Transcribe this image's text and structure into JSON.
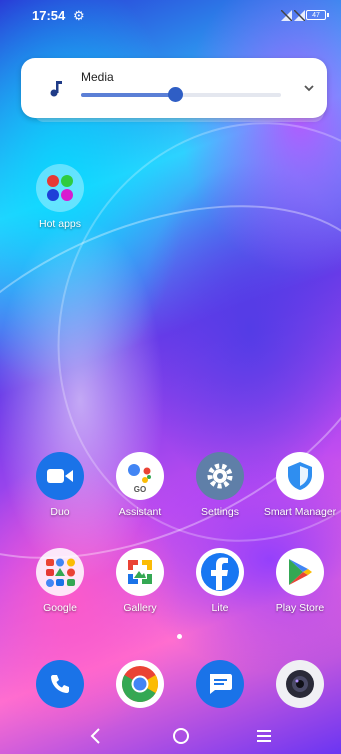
{
  "status_bar": {
    "time": "17:54",
    "battery": "47"
  },
  "volume_panel": {
    "label": "Media",
    "level": 0.47
  },
  "home": {
    "hot_apps": "Hot apps",
    "row1": [
      "Duo",
      "Assistant",
      "Settings",
      "Smart Manager"
    ],
    "row2": [
      "Google",
      "Gallery",
      "Lite",
      "Play Store"
    ],
    "assistant_badge": "GO"
  },
  "icons": {
    "settings": "gear-icon",
    "volume": "music-note-icon",
    "expand": "chevron-down-icon",
    "nav_back": "back-icon",
    "nav_home": "home-icon",
    "nav_recents": "menu-icon"
  },
  "colors": {
    "duo": "#1a73e8",
    "phone": "#1a73e8",
    "messages": "#1a73e8",
    "slider": "#2f5ec5"
  }
}
